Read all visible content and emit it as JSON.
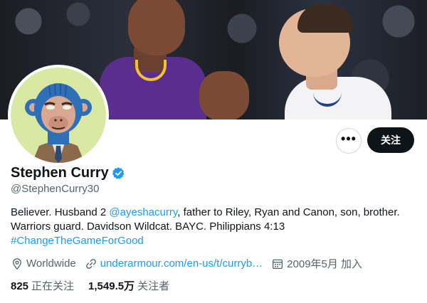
{
  "profile": {
    "name": "Stephen Curry",
    "handle": "@StephenCurry30",
    "bio": {
      "part1": "Believer. Husband 2 ",
      "mention": "@ayeshacurry",
      "part2": ", father to Riley, Ryan and Canon, son, brother. Warriors guard. Davidson Wildcat. BAYC. Philippians 4:13",
      "hashtag": "#ChangeTheGameForGood"
    },
    "location": "Worldwide",
    "website": "underarmour.com/en-us/t/curryb…",
    "joined": "2009年5月 加入",
    "following_count": "825",
    "following_label": "正在关注",
    "followers_count": "1,549.5万",
    "followers_label": "关注者"
  },
  "actions": {
    "more_label": "•••",
    "follow_label": "关注"
  },
  "colors": {
    "accent": "#1d9bf0",
    "verified": "#1d9bf0",
    "text": "#0f1419",
    "secondary": "#536471",
    "follow_bg": "#0f1419",
    "avatar_bg": "#d9e9a4"
  },
  "icons": [
    "more-icon",
    "verified-badge-icon",
    "location-icon",
    "link-icon",
    "calendar-icon"
  ]
}
